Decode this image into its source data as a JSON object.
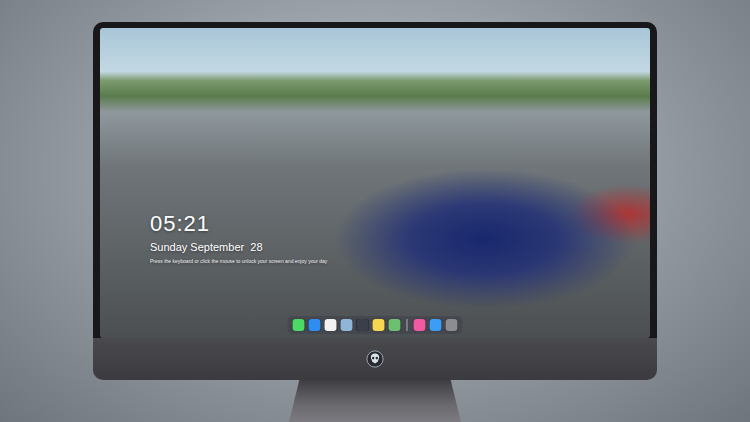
{
  "lock_screen": {
    "clock": "05:21",
    "date": "Sunday September  28",
    "hint": "Press the keyboard or click the mouse to unlock your screen and enjoy your day"
  },
  "dock": [
    {
      "kind": "app",
      "color": "#4cd964"
    },
    {
      "kind": "app",
      "color": "#2f8cf0"
    },
    {
      "kind": "app",
      "color": "#f2f2f2"
    },
    {
      "kind": "app",
      "color": "#8fb6d8"
    },
    {
      "kind": "app",
      "color": "#3a3f4a"
    },
    {
      "kind": "app",
      "color": "#f7d654"
    },
    {
      "kind": "app",
      "color": "#6cc070"
    },
    {
      "kind": "separator"
    },
    {
      "kind": "app",
      "color": "#f05aa0"
    },
    {
      "kind": "app",
      "color": "#3d9cf5"
    },
    {
      "kind": "app",
      "color": "#8c8c92"
    }
  ]
}
